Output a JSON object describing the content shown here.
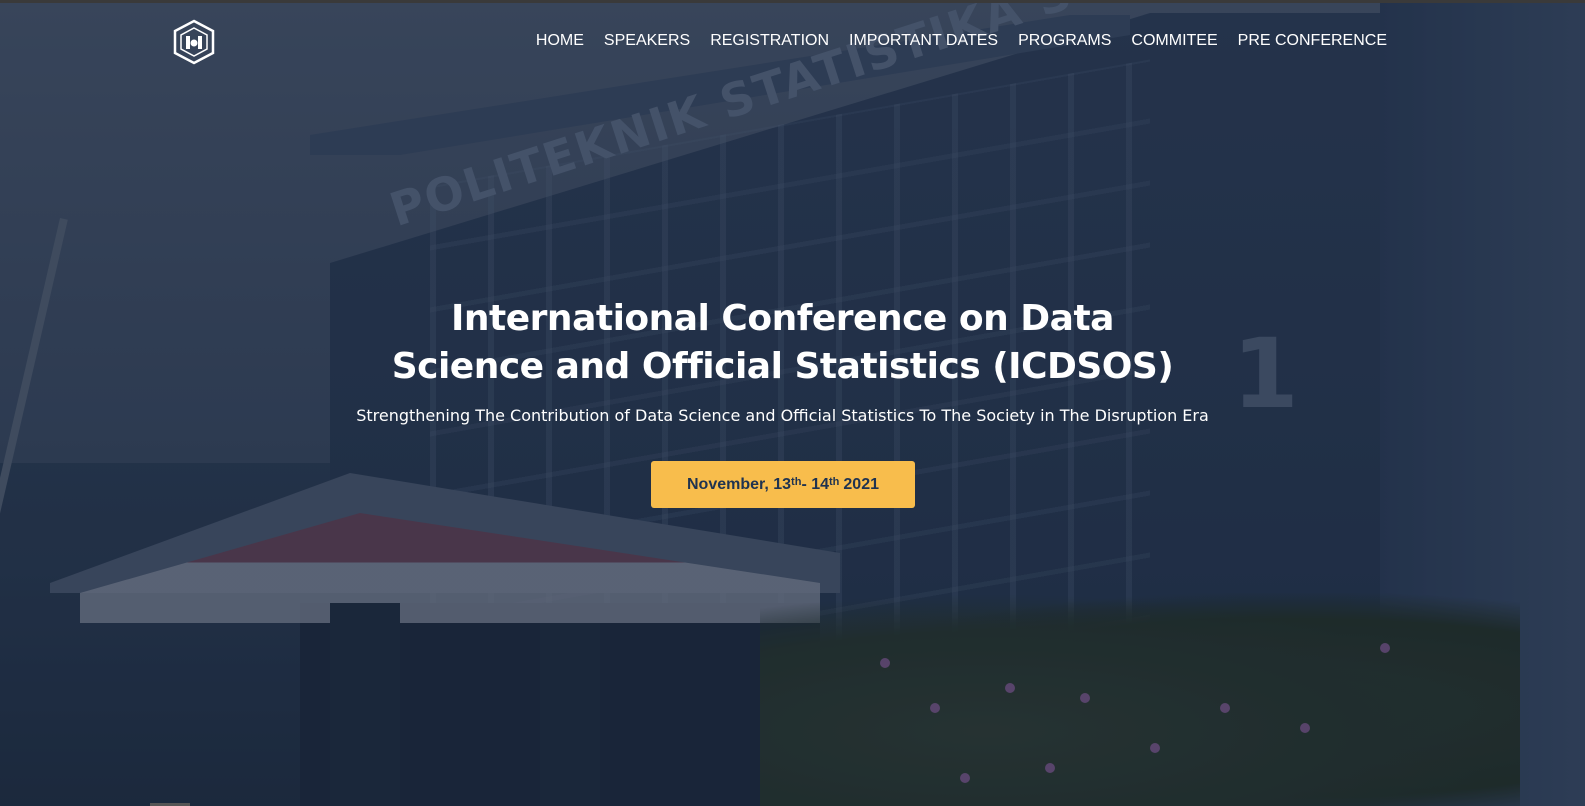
{
  "site": {
    "logo_icon": "icdsos-hexagon-logo-icon"
  },
  "nav": {
    "items": [
      {
        "label": "HOME"
      },
      {
        "label": "SPEAKERS"
      },
      {
        "label": "REGISTRATION"
      },
      {
        "label": "IMPORTANT DATES"
      },
      {
        "label": "PROGRAMS"
      },
      {
        "label": "COMMITEE"
      },
      {
        "label": "PRE CONFERENCE"
      }
    ]
  },
  "hero": {
    "title_line1": "International Conference on Data",
    "title_line2": "Science and Official Statistics (ICDSOS)",
    "subtitle": "Strengthening The Contribution of Data Science and Official Statistics To The Society in The Disruption Era",
    "background": {
      "building_sign": "POLITEKNIK STATISTIKA S",
      "building_number": "1"
    },
    "date_button": {
      "month_prefix": "November, 13",
      "sup1": "th",
      "separator": " - 14",
      "sup2": "th",
      "year": "2021"
    }
  },
  "colors": {
    "accent": "#f8bd4c",
    "accent_text": "#1f3350",
    "overlay": "#16263e"
  }
}
